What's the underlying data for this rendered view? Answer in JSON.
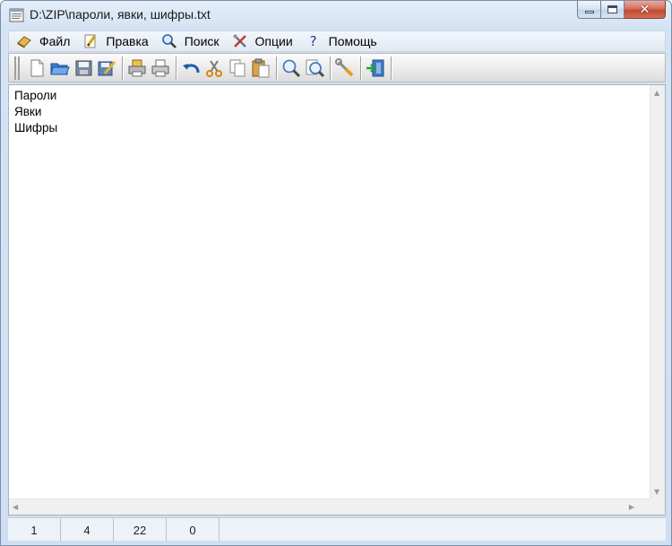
{
  "window": {
    "title": "D:\\ZIP\\пароли, явки, шифры.txt",
    "icons": {
      "app": "notepad-app-icon",
      "minimize": "minimize-icon",
      "maximize": "maximize-icon",
      "close": "close-icon"
    },
    "controls": {
      "close_glyph": "✕"
    }
  },
  "menu": {
    "items": [
      {
        "label": "Файл",
        "icon": "file-menu-icon"
      },
      {
        "label": "Правка",
        "icon": "edit-menu-icon"
      },
      {
        "label": "Поиск",
        "icon": "search-icon"
      },
      {
        "label": "Опции",
        "icon": "options-tools-icon"
      },
      {
        "label": "Помощь",
        "icon": "help-icon"
      }
    ],
    "help_glyph": "?"
  },
  "toolbar": {
    "buttons": [
      "new-file-icon",
      "open-folder-icon",
      "save-disk-icon",
      "save-as-icon",
      "print-icon",
      "print-preview-icon",
      "undo-icon",
      "cut-icon",
      "copy-icon",
      "paste-icon",
      "find-icon",
      "replace-icon",
      "settings-icon",
      "exit-icon"
    ]
  },
  "editor": {
    "lines": [
      "Пароли",
      "Явки",
      "Шифры"
    ]
  },
  "scrollbars": {
    "up": "▲",
    "down": "▼",
    "left": "◀",
    "right": "▶"
  },
  "status": {
    "line": "1",
    "col": "4",
    "chars": "22",
    "modified": "0"
  },
  "colors": {
    "accent": "#c24a33",
    "menu_bg": "#e1e9f4",
    "frame": "#cfdff1"
  }
}
